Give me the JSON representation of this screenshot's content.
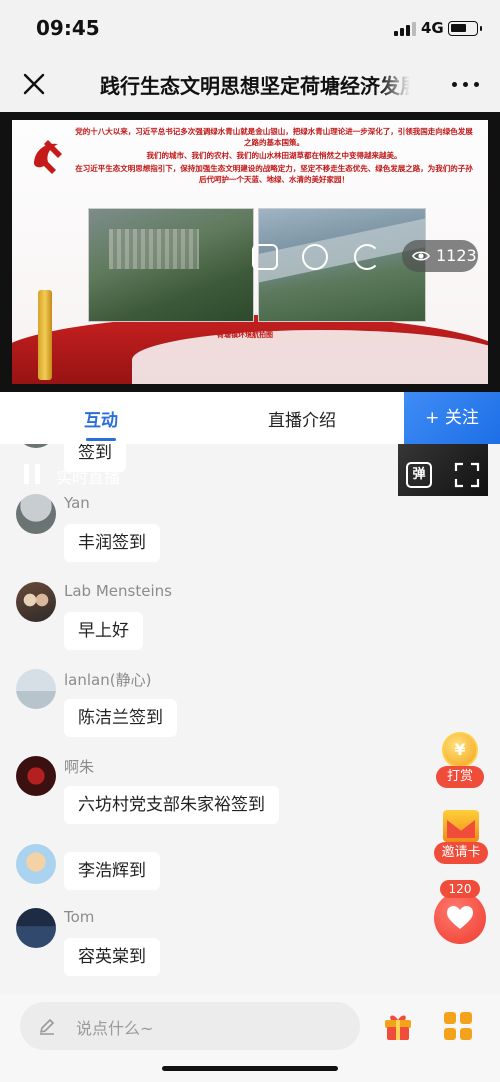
{
  "status_bar": {
    "time": "09:45",
    "network": "4G"
  },
  "nav": {
    "title": "践行生态文明思想坚定荷塘经济发展"
  },
  "video": {
    "viewer_count": "1123",
    "live_label": "实时直播",
    "danmu_label": "弹",
    "slide": {
      "paragraphs": [
        "党的十八大以来，习近平总书记多次强调绿水青山就是金山银山，把绿水青山理论进一步深化了，引领我国走向绿色发展之路的基本国策。",
        "我们的城市、我们的农村、我们的山水林田湖草都在悄然之中变得越来越美。",
        "在习近平生态文明思想指引下，保持加强生态文明建设的战略定力，坚定不移走生态优先、绿色发展之路，为我们的子孙后代呵护一个天蓝、地绿、水清的美好家园！"
      ],
      "caption": "荷塘镇环境航拍图"
    }
  },
  "tabs": {
    "interact": "互动",
    "intro": "直播介绍",
    "follow": "+ 关注"
  },
  "messages": [
    {
      "nick": "",
      "text": "签到"
    },
    {
      "nick": "Yan",
      "text": "丰润签到"
    },
    {
      "nick": "Lab Mensteins",
      "text": "早上好"
    },
    {
      "nick": "lanlan(静心)",
      "text": "陈洁兰签到"
    },
    {
      "nick": "啊朱",
      "text": "六坊村党支部朱家裕签到"
    },
    {
      "nick": "",
      "text": "李浩辉到"
    },
    {
      "nick": "Tom",
      "text": "容英棠到"
    }
  ],
  "floating": {
    "tip_label": "打赏",
    "tip_icon_char": "¥",
    "invite_label": "邀请卡",
    "like_count": "120"
  },
  "bottom": {
    "input_placeholder": "说点什么~"
  },
  "colors": {
    "accent": "#2a6edb",
    "red": "#ef4d3a",
    "gold": "#f3a21b"
  }
}
